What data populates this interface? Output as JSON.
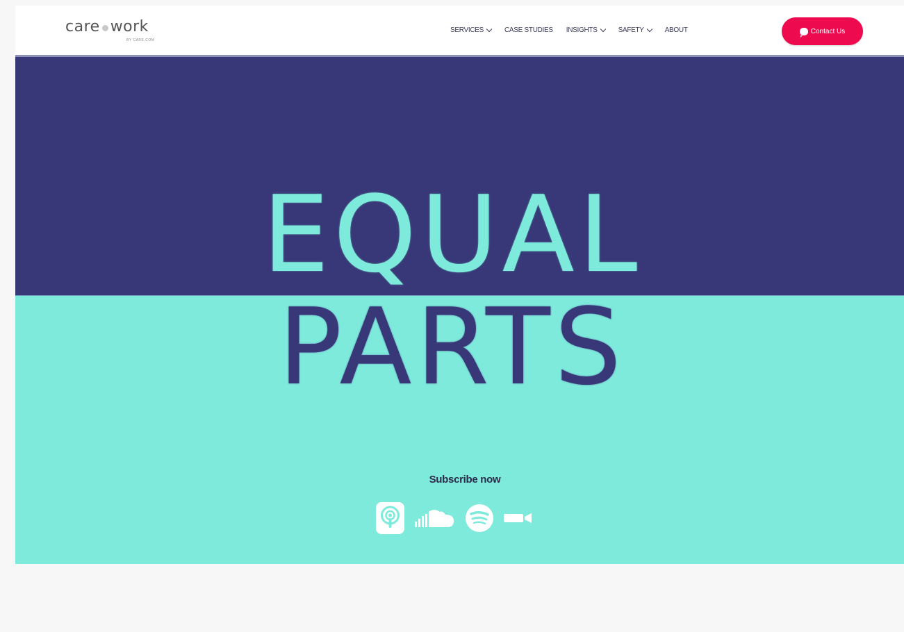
{
  "brand": {
    "logo_left": "care",
    "logo_right": "work",
    "logo_sub": "BY CARE.COM"
  },
  "nav": {
    "items": [
      {
        "label": "SERVICES",
        "dropdown": true
      },
      {
        "label": "CASE STUDIES",
        "dropdown": false
      },
      {
        "label": "INSIGHTS",
        "dropdown": true
      },
      {
        "label": "SAFETY",
        "dropdown": true
      },
      {
        "label": "ABOUT",
        "dropdown": false
      }
    ],
    "contact_label": "Contact Us"
  },
  "hero": {
    "title_line1": "EQUAL",
    "title_line2": "PARTS",
    "subscribe_label": "Subscribe now",
    "platform_icons": [
      "apple-podcasts-icon",
      "soundcloud-icon",
      "spotify-icon",
      "video-camera-icon"
    ]
  },
  "colors": {
    "navy": "#383878",
    "mint": "#7eeadb",
    "accent": "#ee0a4f"
  }
}
